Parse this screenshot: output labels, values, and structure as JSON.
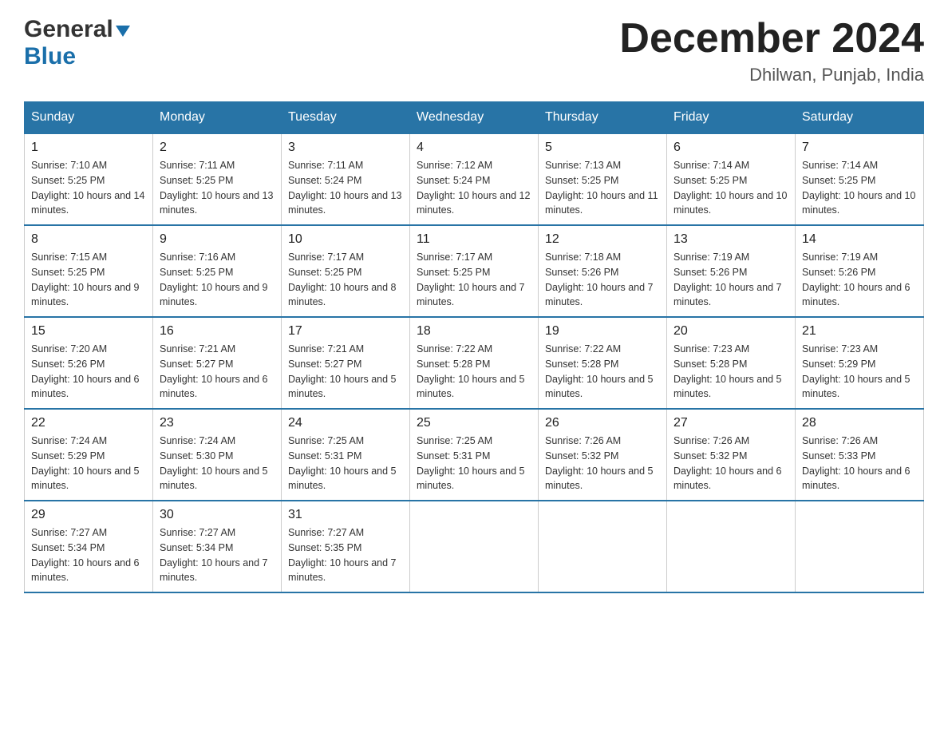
{
  "header": {
    "logo_general": "General",
    "logo_blue": "Blue",
    "month_title": "December 2024",
    "location": "Dhilwan, Punjab, India"
  },
  "days_of_week": [
    "Sunday",
    "Monday",
    "Tuesday",
    "Wednesday",
    "Thursday",
    "Friday",
    "Saturday"
  ],
  "weeks": [
    [
      {
        "day": "1",
        "sunrise": "7:10 AM",
        "sunset": "5:25 PM",
        "daylight": "10 hours and 14 minutes."
      },
      {
        "day": "2",
        "sunrise": "7:11 AM",
        "sunset": "5:25 PM",
        "daylight": "10 hours and 13 minutes."
      },
      {
        "day": "3",
        "sunrise": "7:11 AM",
        "sunset": "5:24 PM",
        "daylight": "10 hours and 13 minutes."
      },
      {
        "day": "4",
        "sunrise": "7:12 AM",
        "sunset": "5:24 PM",
        "daylight": "10 hours and 12 minutes."
      },
      {
        "day": "5",
        "sunrise": "7:13 AM",
        "sunset": "5:25 PM",
        "daylight": "10 hours and 11 minutes."
      },
      {
        "day": "6",
        "sunrise": "7:14 AM",
        "sunset": "5:25 PM",
        "daylight": "10 hours and 10 minutes."
      },
      {
        "day": "7",
        "sunrise": "7:14 AM",
        "sunset": "5:25 PM",
        "daylight": "10 hours and 10 minutes."
      }
    ],
    [
      {
        "day": "8",
        "sunrise": "7:15 AM",
        "sunset": "5:25 PM",
        "daylight": "10 hours and 9 minutes."
      },
      {
        "day": "9",
        "sunrise": "7:16 AM",
        "sunset": "5:25 PM",
        "daylight": "10 hours and 9 minutes."
      },
      {
        "day": "10",
        "sunrise": "7:17 AM",
        "sunset": "5:25 PM",
        "daylight": "10 hours and 8 minutes."
      },
      {
        "day": "11",
        "sunrise": "7:17 AM",
        "sunset": "5:25 PM",
        "daylight": "10 hours and 7 minutes."
      },
      {
        "day": "12",
        "sunrise": "7:18 AM",
        "sunset": "5:26 PM",
        "daylight": "10 hours and 7 minutes."
      },
      {
        "day": "13",
        "sunrise": "7:19 AM",
        "sunset": "5:26 PM",
        "daylight": "10 hours and 7 minutes."
      },
      {
        "day": "14",
        "sunrise": "7:19 AM",
        "sunset": "5:26 PM",
        "daylight": "10 hours and 6 minutes."
      }
    ],
    [
      {
        "day": "15",
        "sunrise": "7:20 AM",
        "sunset": "5:26 PM",
        "daylight": "10 hours and 6 minutes."
      },
      {
        "day": "16",
        "sunrise": "7:21 AM",
        "sunset": "5:27 PM",
        "daylight": "10 hours and 6 minutes."
      },
      {
        "day": "17",
        "sunrise": "7:21 AM",
        "sunset": "5:27 PM",
        "daylight": "10 hours and 5 minutes."
      },
      {
        "day": "18",
        "sunrise": "7:22 AM",
        "sunset": "5:28 PM",
        "daylight": "10 hours and 5 minutes."
      },
      {
        "day": "19",
        "sunrise": "7:22 AM",
        "sunset": "5:28 PM",
        "daylight": "10 hours and 5 minutes."
      },
      {
        "day": "20",
        "sunrise": "7:23 AM",
        "sunset": "5:28 PM",
        "daylight": "10 hours and 5 minutes."
      },
      {
        "day": "21",
        "sunrise": "7:23 AM",
        "sunset": "5:29 PM",
        "daylight": "10 hours and 5 minutes."
      }
    ],
    [
      {
        "day": "22",
        "sunrise": "7:24 AM",
        "sunset": "5:29 PM",
        "daylight": "10 hours and 5 minutes."
      },
      {
        "day": "23",
        "sunrise": "7:24 AM",
        "sunset": "5:30 PM",
        "daylight": "10 hours and 5 minutes."
      },
      {
        "day": "24",
        "sunrise": "7:25 AM",
        "sunset": "5:31 PM",
        "daylight": "10 hours and 5 minutes."
      },
      {
        "day": "25",
        "sunrise": "7:25 AM",
        "sunset": "5:31 PM",
        "daylight": "10 hours and 5 minutes."
      },
      {
        "day": "26",
        "sunrise": "7:26 AM",
        "sunset": "5:32 PM",
        "daylight": "10 hours and 5 minutes."
      },
      {
        "day": "27",
        "sunrise": "7:26 AM",
        "sunset": "5:32 PM",
        "daylight": "10 hours and 6 minutes."
      },
      {
        "day": "28",
        "sunrise": "7:26 AM",
        "sunset": "5:33 PM",
        "daylight": "10 hours and 6 minutes."
      }
    ],
    [
      {
        "day": "29",
        "sunrise": "7:27 AM",
        "sunset": "5:34 PM",
        "daylight": "10 hours and 6 minutes."
      },
      {
        "day": "30",
        "sunrise": "7:27 AM",
        "sunset": "5:34 PM",
        "daylight": "10 hours and 7 minutes."
      },
      {
        "day": "31",
        "sunrise": "7:27 AM",
        "sunset": "5:35 PM",
        "daylight": "10 hours and 7 minutes."
      },
      null,
      null,
      null,
      null
    ]
  ],
  "labels": {
    "sunrise_prefix": "Sunrise: ",
    "sunset_prefix": "Sunset: ",
    "daylight_prefix": "Daylight: "
  }
}
